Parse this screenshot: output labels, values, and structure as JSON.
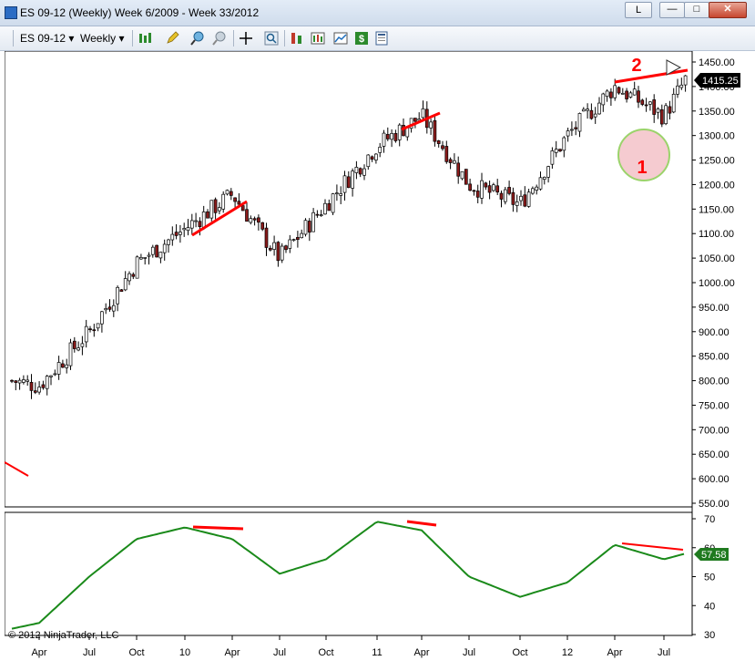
{
  "window": {
    "title": "ES 09-12 (Weekly)  Week 6/2009 - Week 33/2012",
    "link_button": "L",
    "min_glyph": "—",
    "max_glyph": "□",
    "close_glyph": "✕"
  },
  "toolbar": {
    "instrument": "ES 09-12",
    "period": "Weekly",
    "dropdown_glyph": "▾"
  },
  "colors": {
    "bull": "#ffffff",
    "bear": "#8b1a1a",
    "wick": "#000000",
    "annotation": "#ff0000",
    "indicator_line": "#1a8a1a",
    "indicator_badge": "#1f7a1f",
    "price_badge": "#000000"
  },
  "chart": {
    "price_axis_labels": [
      "1450.00",
      "1400.00",
      "1350.00",
      "1300.00",
      "1250.00",
      "1200.00",
      "1150.00",
      "1100.00",
      "1050.00",
      "1000.00",
      "950.00",
      "900.00",
      "850.00",
      "800.00",
      "750.00",
      "700.00",
      "650.00",
      "600.00",
      "550.00"
    ],
    "last_price": "1415.25",
    "indicator_axis_labels": [
      "70",
      "60",
      "50",
      "40",
      "30"
    ],
    "indicator_last": "57.58",
    "time_labels": [
      "Apr",
      "Jul",
      "Oct",
      "10",
      "Apr",
      "Jul",
      "Oct",
      "11",
      "Apr",
      "Jul",
      "Oct",
      "12",
      "Apr",
      "Jul"
    ],
    "annotation_1": "1",
    "annotation_2": "2",
    "copyright": "© 2012 NinjaTrader, LLC"
  },
  "chart_data": {
    "type": "line",
    "title": "ES 09-12 (Weekly)",
    "x": [
      "Feb 2009",
      "Apr 2009",
      "Jul 2009",
      "Oct 2009",
      "Jan 2010",
      "Apr 2010",
      "Jul 2010",
      "Oct 2010",
      "Jan 2011",
      "Apr 2011",
      "Jul 2011",
      "Oct 2011",
      "Jan 2012",
      "Apr 2012",
      "Jul 2012",
      "Aug 2012"
    ],
    "series": [
      {
        "values": [
          800,
          790,
          900,
          1040,
          1110,
          1180,
          1050,
          1160,
          1280,
          1340,
          1200,
          1160,
          1300,
          1400,
          1340,
          1415
        ]
      },
      {
        "values": [
          32,
          34,
          50,
          63,
          67,
          63,
          51,
          56,
          69,
          66,
          50,
          43,
          48,
          61,
          56,
          58
        ]
      }
    ],
    "ylim": [
      550,
      1460
    ],
    "indicator_ylim": [
      28,
      72
    ]
  }
}
